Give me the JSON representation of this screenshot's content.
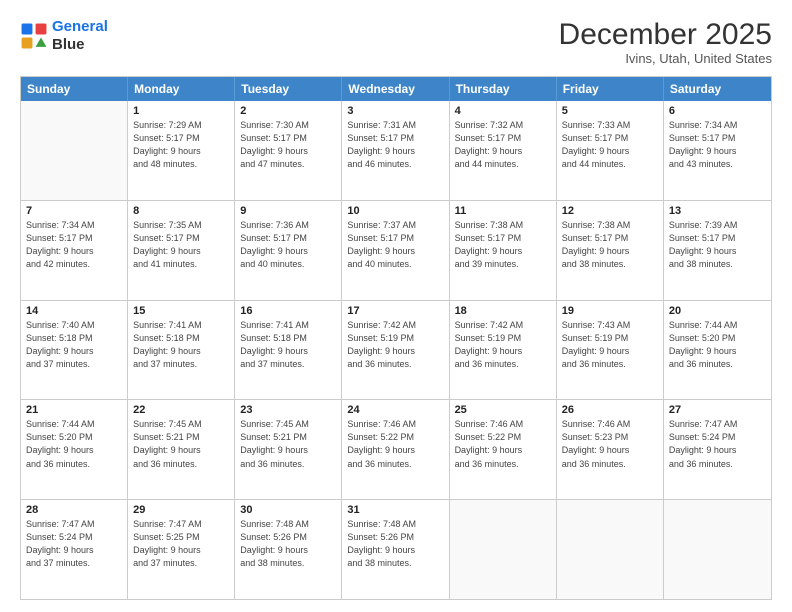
{
  "logo": {
    "line1": "General",
    "line2": "Blue"
  },
  "title": "December 2025",
  "location": "Ivins, Utah, United States",
  "days_of_week": [
    "Sunday",
    "Monday",
    "Tuesday",
    "Wednesday",
    "Thursday",
    "Friday",
    "Saturday"
  ],
  "weeks": [
    [
      {
        "day": "",
        "lines": []
      },
      {
        "day": "1",
        "lines": [
          "Sunrise: 7:29 AM",
          "Sunset: 5:17 PM",
          "Daylight: 9 hours",
          "and 48 minutes."
        ]
      },
      {
        "day": "2",
        "lines": [
          "Sunrise: 7:30 AM",
          "Sunset: 5:17 PM",
          "Daylight: 9 hours",
          "and 47 minutes."
        ]
      },
      {
        "day": "3",
        "lines": [
          "Sunrise: 7:31 AM",
          "Sunset: 5:17 PM",
          "Daylight: 9 hours",
          "and 46 minutes."
        ]
      },
      {
        "day": "4",
        "lines": [
          "Sunrise: 7:32 AM",
          "Sunset: 5:17 PM",
          "Daylight: 9 hours",
          "and 44 minutes."
        ]
      },
      {
        "day": "5",
        "lines": [
          "Sunrise: 7:33 AM",
          "Sunset: 5:17 PM",
          "Daylight: 9 hours",
          "and 44 minutes."
        ]
      },
      {
        "day": "6",
        "lines": [
          "Sunrise: 7:34 AM",
          "Sunset: 5:17 PM",
          "Daylight: 9 hours",
          "and 43 minutes."
        ]
      }
    ],
    [
      {
        "day": "7",
        "lines": [
          "Sunrise: 7:34 AM",
          "Sunset: 5:17 PM",
          "Daylight: 9 hours",
          "and 42 minutes."
        ]
      },
      {
        "day": "8",
        "lines": [
          "Sunrise: 7:35 AM",
          "Sunset: 5:17 PM",
          "Daylight: 9 hours",
          "and 41 minutes."
        ]
      },
      {
        "day": "9",
        "lines": [
          "Sunrise: 7:36 AM",
          "Sunset: 5:17 PM",
          "Daylight: 9 hours",
          "and 40 minutes."
        ]
      },
      {
        "day": "10",
        "lines": [
          "Sunrise: 7:37 AM",
          "Sunset: 5:17 PM",
          "Daylight: 9 hours",
          "and 40 minutes."
        ]
      },
      {
        "day": "11",
        "lines": [
          "Sunrise: 7:38 AM",
          "Sunset: 5:17 PM",
          "Daylight: 9 hours",
          "and 39 minutes."
        ]
      },
      {
        "day": "12",
        "lines": [
          "Sunrise: 7:38 AM",
          "Sunset: 5:17 PM",
          "Daylight: 9 hours",
          "and 38 minutes."
        ]
      },
      {
        "day": "13",
        "lines": [
          "Sunrise: 7:39 AM",
          "Sunset: 5:17 PM",
          "Daylight: 9 hours",
          "and 38 minutes."
        ]
      }
    ],
    [
      {
        "day": "14",
        "lines": [
          "Sunrise: 7:40 AM",
          "Sunset: 5:18 PM",
          "Daylight: 9 hours",
          "and 37 minutes."
        ]
      },
      {
        "day": "15",
        "lines": [
          "Sunrise: 7:41 AM",
          "Sunset: 5:18 PM",
          "Daylight: 9 hours",
          "and 37 minutes."
        ]
      },
      {
        "day": "16",
        "lines": [
          "Sunrise: 7:41 AM",
          "Sunset: 5:18 PM",
          "Daylight: 9 hours",
          "and 37 minutes."
        ]
      },
      {
        "day": "17",
        "lines": [
          "Sunrise: 7:42 AM",
          "Sunset: 5:19 PM",
          "Daylight: 9 hours",
          "and 36 minutes."
        ]
      },
      {
        "day": "18",
        "lines": [
          "Sunrise: 7:42 AM",
          "Sunset: 5:19 PM",
          "Daylight: 9 hours",
          "and 36 minutes."
        ]
      },
      {
        "day": "19",
        "lines": [
          "Sunrise: 7:43 AM",
          "Sunset: 5:19 PM",
          "Daylight: 9 hours",
          "and 36 minutes."
        ]
      },
      {
        "day": "20",
        "lines": [
          "Sunrise: 7:44 AM",
          "Sunset: 5:20 PM",
          "Daylight: 9 hours",
          "and 36 minutes."
        ]
      }
    ],
    [
      {
        "day": "21",
        "lines": [
          "Sunrise: 7:44 AM",
          "Sunset: 5:20 PM",
          "Daylight: 9 hours",
          "and 36 minutes."
        ]
      },
      {
        "day": "22",
        "lines": [
          "Sunrise: 7:45 AM",
          "Sunset: 5:21 PM",
          "Daylight: 9 hours",
          "and 36 minutes."
        ]
      },
      {
        "day": "23",
        "lines": [
          "Sunrise: 7:45 AM",
          "Sunset: 5:21 PM",
          "Daylight: 9 hours",
          "and 36 minutes."
        ]
      },
      {
        "day": "24",
        "lines": [
          "Sunrise: 7:46 AM",
          "Sunset: 5:22 PM",
          "Daylight: 9 hours",
          "and 36 minutes."
        ]
      },
      {
        "day": "25",
        "lines": [
          "Sunrise: 7:46 AM",
          "Sunset: 5:22 PM",
          "Daylight: 9 hours",
          "and 36 minutes."
        ]
      },
      {
        "day": "26",
        "lines": [
          "Sunrise: 7:46 AM",
          "Sunset: 5:23 PM",
          "Daylight: 9 hours",
          "and 36 minutes."
        ]
      },
      {
        "day": "27",
        "lines": [
          "Sunrise: 7:47 AM",
          "Sunset: 5:24 PM",
          "Daylight: 9 hours",
          "and 36 minutes."
        ]
      }
    ],
    [
      {
        "day": "28",
        "lines": [
          "Sunrise: 7:47 AM",
          "Sunset: 5:24 PM",
          "Daylight: 9 hours",
          "and 37 minutes."
        ]
      },
      {
        "day": "29",
        "lines": [
          "Sunrise: 7:47 AM",
          "Sunset: 5:25 PM",
          "Daylight: 9 hours",
          "and 37 minutes."
        ]
      },
      {
        "day": "30",
        "lines": [
          "Sunrise: 7:48 AM",
          "Sunset: 5:26 PM",
          "Daylight: 9 hours",
          "and 38 minutes."
        ]
      },
      {
        "day": "31",
        "lines": [
          "Sunrise: 7:48 AM",
          "Sunset: 5:26 PM",
          "Daylight: 9 hours",
          "and 38 minutes."
        ]
      },
      {
        "day": "",
        "lines": []
      },
      {
        "day": "",
        "lines": []
      },
      {
        "day": "",
        "lines": []
      }
    ]
  ]
}
